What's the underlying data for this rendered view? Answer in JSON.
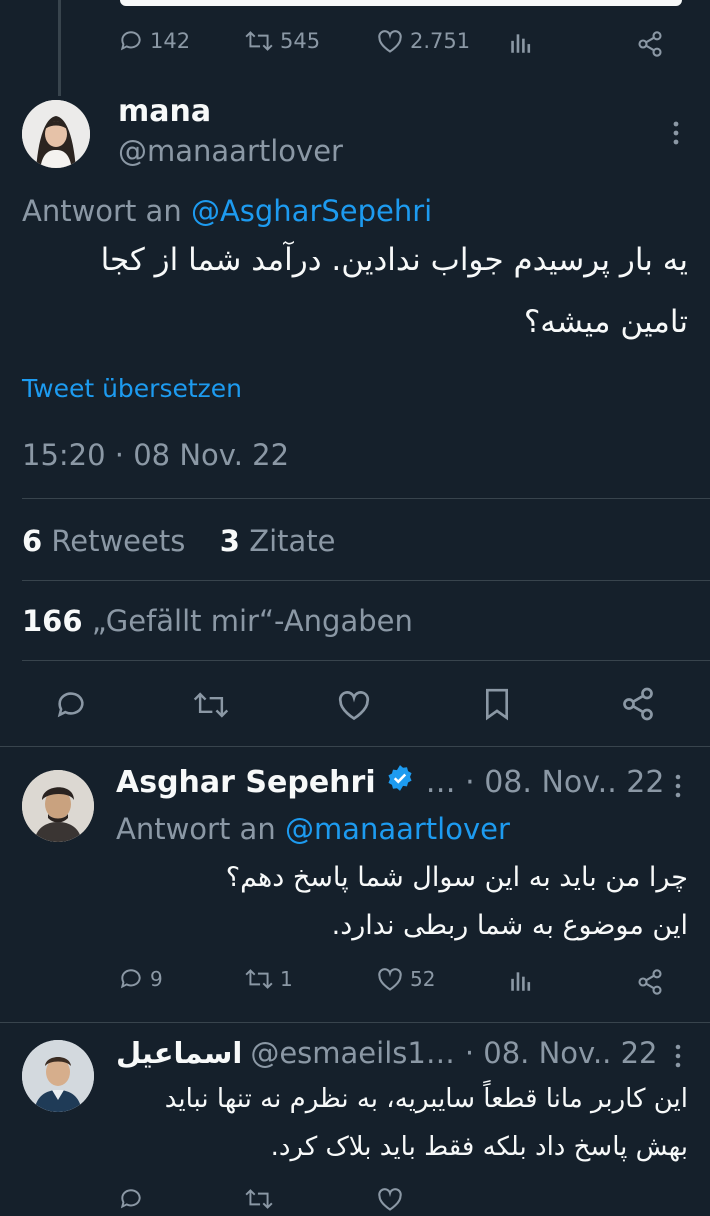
{
  "top_tweet": {
    "stats": {
      "replies": "142",
      "retweets": "545",
      "likes": "2.751"
    }
  },
  "main_tweet": {
    "display_name": "mana",
    "handle": "@manaartlover",
    "reply_prefix": "Antwort an",
    "reply_to": "@AsgharSepehri",
    "text_line1": "یه بار پرسیدم جواب ندادین. درآمد شما از کجا",
    "text_line2": "تامین میشه؟",
    "translate": "Tweet übersetzen",
    "timestamp": "15:20 · 08 Nov. 22",
    "retweets_count": "6",
    "retweets_label": "Retweets",
    "quotes_count": "3",
    "quotes_label": "Zitate",
    "likes_count": "166",
    "likes_label": "„Gefällt mir“-Angaben"
  },
  "reply1": {
    "display_name": "Asghar Sepehri",
    "meta": "… · 08. Nov.. 22",
    "reply_prefix": "Antwort an",
    "reply_to": "@manaartlover",
    "text_line1": "چرا من باید به این سوال شما پاسخ دهم؟",
    "text_line2": "این موضوع به شما ربطی ندارد.",
    "stats": {
      "replies": "9",
      "retweets": "1",
      "likes": "52"
    }
  },
  "reply2": {
    "display_name": "اسماعیل",
    "handle": "@esmaeils1…",
    "meta": "· 08. Nov.. 22",
    "text_line1": "این کاربر مانا قطعاً سایبریه، به نظرم نه تنها نباید",
    "text_line2": "بهش پاسخ داد بلکه فقط باید بلاک کرد."
  },
  "colors": {
    "background": "#15202b",
    "muted": "#8b98a5",
    "link": "#1d9bf0",
    "text": "#f7f9f9",
    "divider": "#38444d"
  }
}
